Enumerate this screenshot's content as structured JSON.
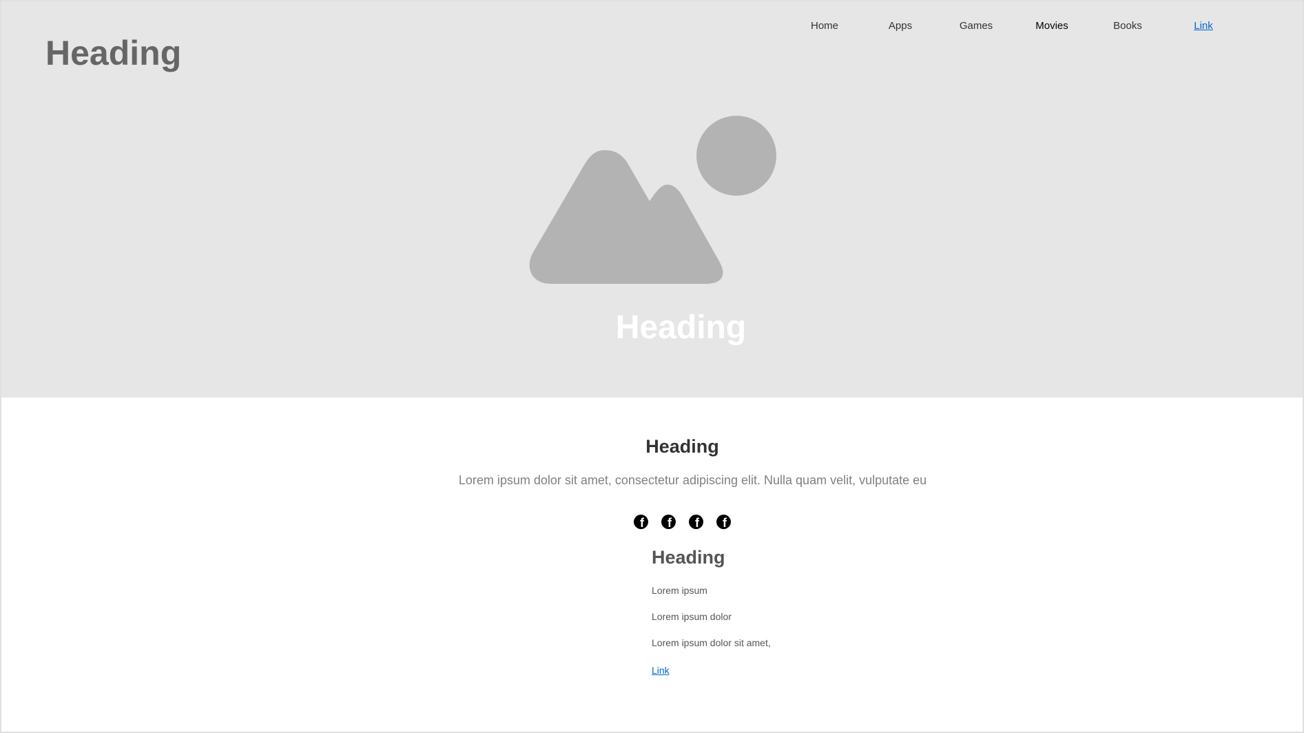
{
  "header": {
    "brand": "Heading"
  },
  "nav": {
    "items": [
      {
        "label": "Home",
        "active": false
      },
      {
        "label": "Apps",
        "active": false
      },
      {
        "label": "Games",
        "active": false
      },
      {
        "label": "Movies",
        "active": true
      },
      {
        "label": "Books",
        "active": false
      }
    ],
    "link_label": "Link"
  },
  "hero": {
    "image_icon": "image-placeholder-icon",
    "title": "Heading"
  },
  "content": {
    "title": "Heading",
    "lede": "Lorem ipsum dolor sit amet, consectetur adipiscing elit. Nulla quam velit, vulputate eu",
    "social_icons": [
      "facebook-icon",
      "facebook-icon",
      "facebook-icon",
      "facebook-icon"
    ],
    "list": {
      "title": "Heading",
      "items": [
        "Lorem ipsum",
        "Lorem ipsum dolor",
        "Lorem ipsum dolor sit amet,"
      ],
      "link_label": "Link"
    }
  },
  "colors": {
    "hero_background": "#e6e6e6",
    "placeholder_gray": "#b3b3b3",
    "link": "#0066cc",
    "brand_text": "#666666"
  }
}
